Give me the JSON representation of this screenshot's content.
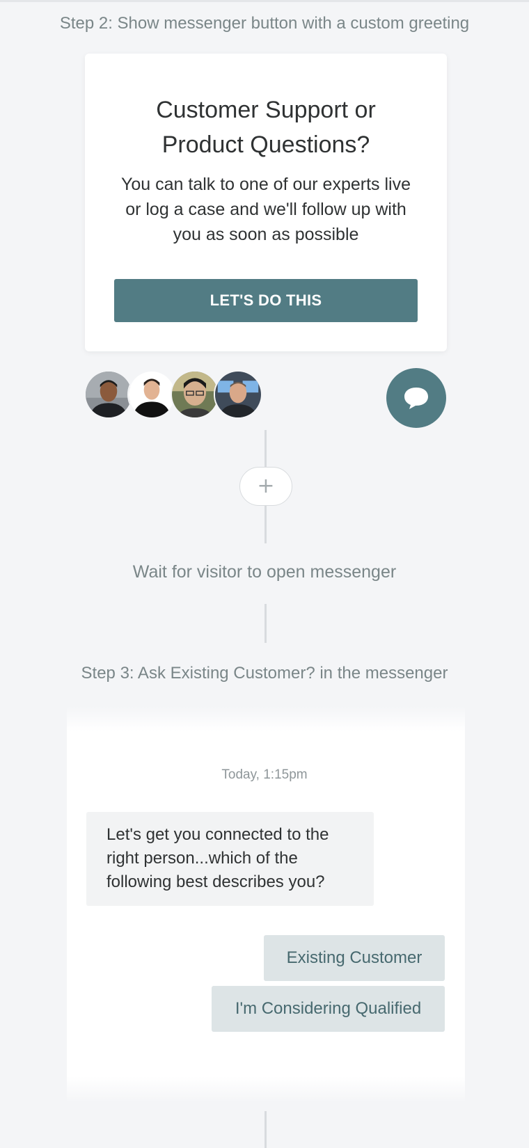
{
  "step2": {
    "title": "Step 2: Show messenger button with a custom greeting",
    "card": {
      "title": "Customer Support or Product Questions?",
      "body": "You can talk to one of our experts live or log a case and we'll follow up with you as soon as possible",
      "button_label": "LET'S DO THIS"
    },
    "messenger_icon": "chat-bubble-icon"
  },
  "connector": {
    "add_icon": "plus-icon",
    "add_symbol": "+"
  },
  "wait": {
    "label": "Wait for visitor to open messenger"
  },
  "step3": {
    "title": "Step 3: Ask Existing Customer? in the messenger",
    "timestamp": "Today, 1:15pm",
    "bot_message": "Let's get you connected to the right person...which of the following best describes you?",
    "options": [
      "Existing Customer",
      "I'm Considering Qualified"
    ]
  },
  "colors": {
    "accent": "#527c84",
    "background": "#f4f5f7",
    "option_bg": "#dde4e6",
    "option_text": "#47696f"
  }
}
